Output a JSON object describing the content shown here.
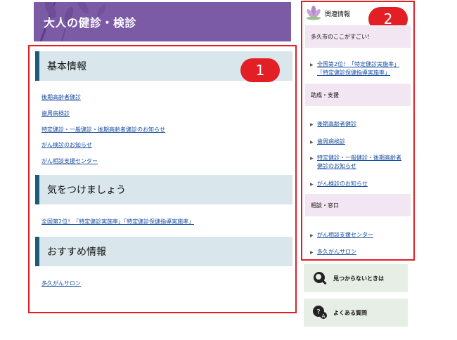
{
  "banner": {
    "title": "大人の健診・検診"
  },
  "markers": {
    "main": "1",
    "side": "2"
  },
  "sections": [
    {
      "title": "基本情報",
      "links": [
        "後期高齢者健診",
        "歯周病検診",
        "特定健診・一般健診・後期高齢者健診のお知らせ",
        "がん検診のお知らせ",
        "がん相談支援センター"
      ]
    },
    {
      "title": "気をつけましょう",
      "links": [
        "全国第2位！「特定健診実施率」「特定健診保健指導実施率」"
      ]
    },
    {
      "title": "おすすめ情報",
      "links": [
        "多久がんサロン"
      ]
    }
  ],
  "sidebar": {
    "title": "関連情報",
    "categories": [
      {
        "title": "多久市のここがすごい！",
        "links": [
          [
            "全国第2位！「特定健診実施率」",
            "「特定健診保健指導実施率」"
          ]
        ]
      },
      {
        "title": "助成・支援",
        "links": [
          [
            "後期高齢者健診"
          ],
          [
            "歯周病検診"
          ],
          [
            "特定健診・一般健診・後期高齢者",
            "健診のお知らせ"
          ],
          [
            "がん検診のお知らせ"
          ]
        ]
      },
      {
        "title": "相談・窓口",
        "links": [
          [
            "がん相談支援センター"
          ],
          [
            "多久がんサロン"
          ]
        ]
      }
    ]
  },
  "buttons": {
    "not_found": "見つからないときは",
    "faq": "よくある質問"
  },
  "colors": {
    "accent": "#e31f26",
    "banner": "#7b5aa6",
    "header_bar": "#1e5b78",
    "link": "#1a4fa0"
  }
}
